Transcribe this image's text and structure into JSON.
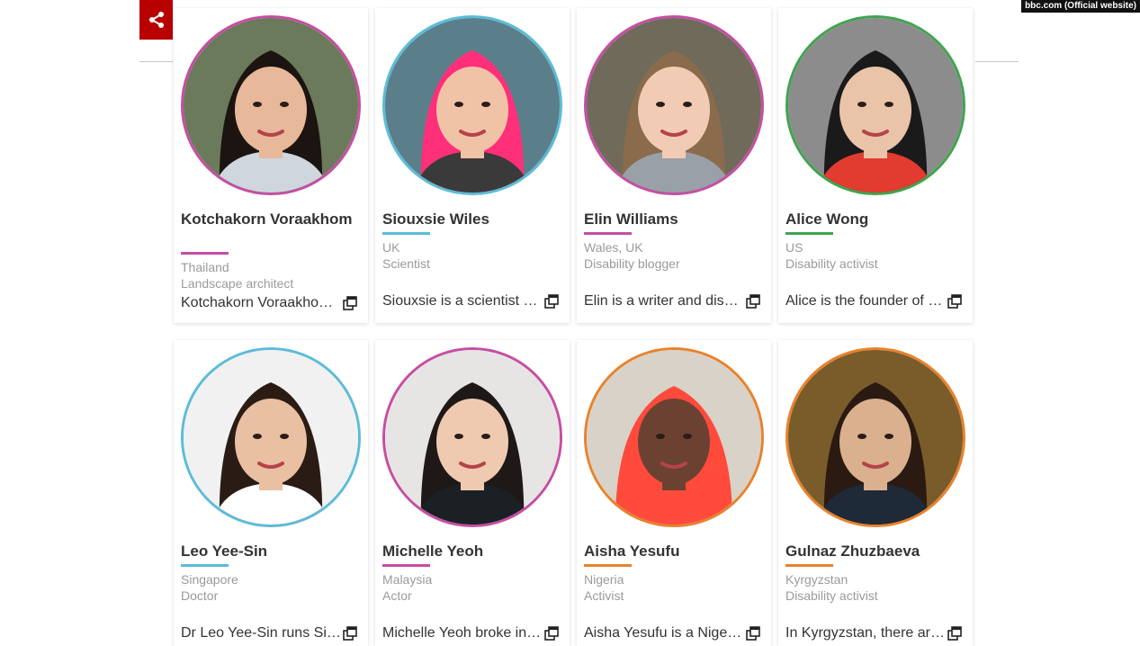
{
  "source_badge": "bbc.com (Official website)",
  "cards": [
    {
      "name": "Kotchakorn Voraakhom",
      "country": "Thailand",
      "role": "Landscape architect",
      "summary": "Kotchakorn Voraakhom is a landscape architect",
      "color": "#c54ea3",
      "portrait": "portrait-kotchakorn-voraakhom"
    },
    {
      "name": "Siouxsie Wiles",
      "country": "UK",
      "role": "Scientist",
      "summary": "Siouxsie is a scientist and microbiologist",
      "color": "#5bbcd8",
      "portrait": "portrait-siouxsie-wiles"
    },
    {
      "name": "Elin Williams",
      "country": "Wales, UK",
      "role": "Disability blogger",
      "summary": "Elin is a writer and disability blogger",
      "color": "#c54ea3",
      "portrait": "portrait-elin-williams"
    },
    {
      "name": "Alice Wong",
      "country": "US",
      "role": "Disability activist",
      "summary": "Alice is the founder of the Disability Visibility Project",
      "color": "#3fa44f",
      "portrait": "portrait-alice-wong"
    },
    {
      "name": "Leo Yee-Sin",
      "country": "Singapore",
      "role": "Doctor",
      "summary": "Dr Leo Yee-Sin runs Singapore's centre",
      "color": "#5bbcd8",
      "portrait": "portrait-leo-yee-sin"
    },
    {
      "name": "Michelle Yeoh",
      "country": "Malaysia",
      "role": "Actor",
      "summary": "Michelle Yeoh broke into the film industry",
      "color": "#c54ea3",
      "portrait": "portrait-michelle-yeoh"
    },
    {
      "name": "Aisha Yesufu",
      "country": "Nigeria",
      "role": "Activist",
      "summary": "Aisha Yesufu is a Nigerian activist",
      "color": "#e8822c",
      "portrait": "portrait-aisha-yesufu"
    },
    {
      "name": "Gulnaz Zhuzbaeva",
      "country": "Kyrgyzstan",
      "role": "Disability activist",
      "summary": "In Kyrgyzstan, there are many barriers",
      "color": "#e8822c",
      "portrait": "portrait-gulnaz-zhuzbaeva"
    }
  ]
}
